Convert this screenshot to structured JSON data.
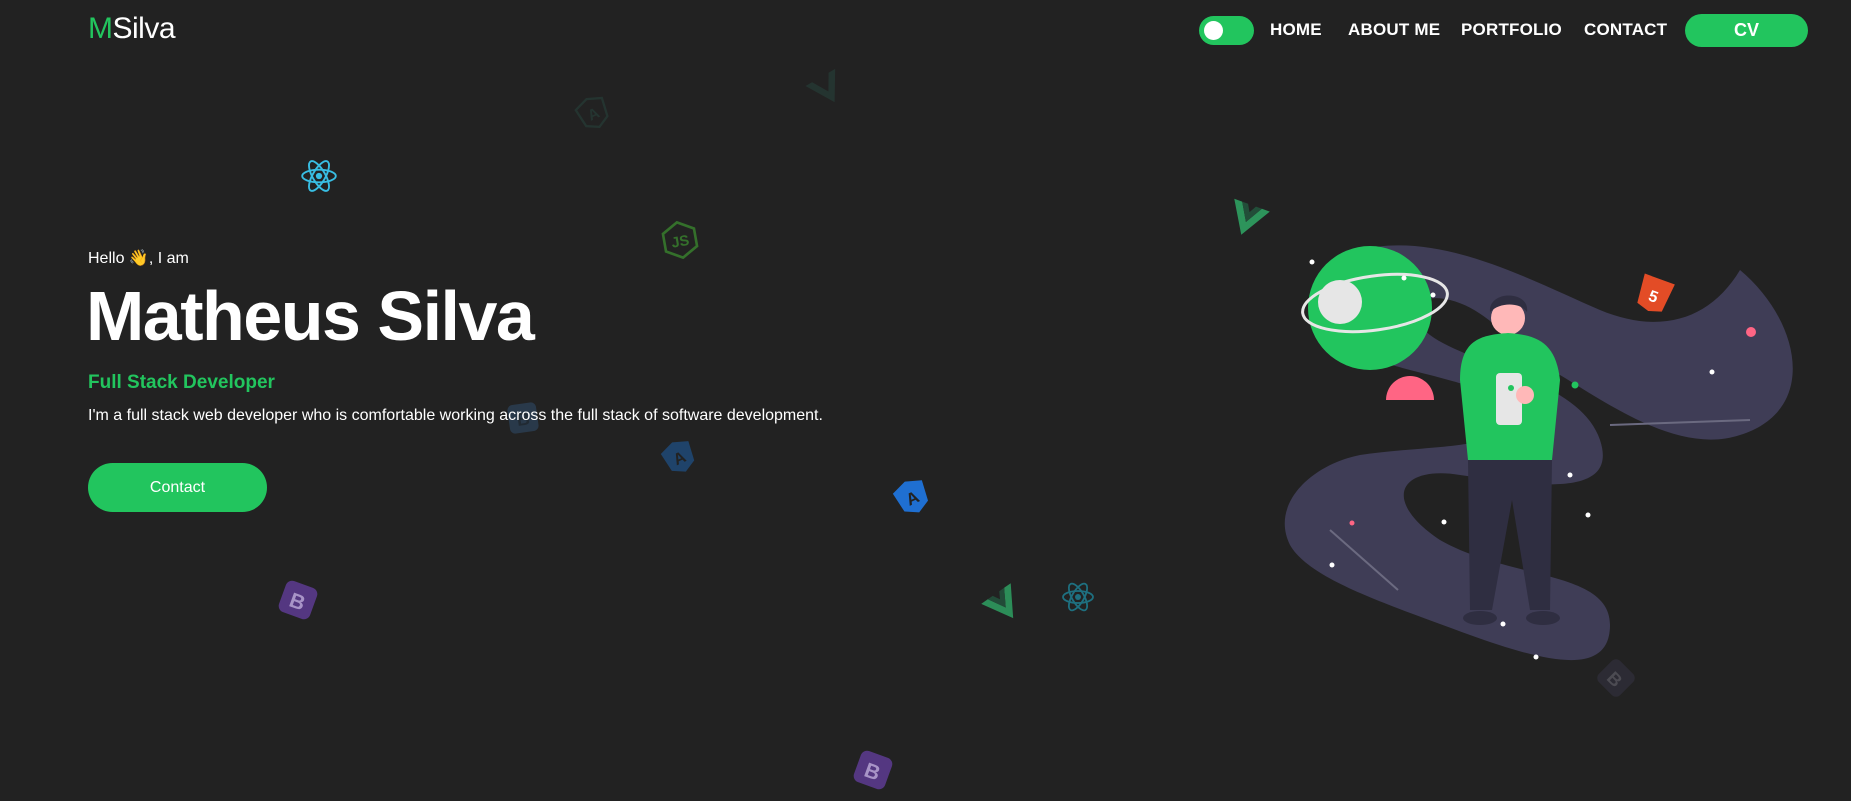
{
  "header": {
    "logo_first": "M",
    "logo_rest": "Silva",
    "theme_toggle_state": "on",
    "nav": [
      {
        "label": "HOME"
      },
      {
        "label": "ABOUT ME"
      },
      {
        "label": "PORTFOLIO"
      },
      {
        "label": "CONTACT"
      }
    ],
    "cv_label": "CV"
  },
  "hero": {
    "greeting": "Hello 👋, I am",
    "name": "Matheus Silva",
    "role": "Full Stack Developer",
    "description": "I'm a full stack web developer who is comfortable working across the full stack of software development.",
    "contact_label": "Contact"
  },
  "floating_icons": [
    "react-icon",
    "nodejs-icon",
    "angular-icon",
    "angular-icon",
    "vue-icon",
    "react-icon",
    "bootstrap-icon",
    "bootstrap-icon",
    "bootstrap-icon",
    "vue-icon",
    "html5-icon",
    "angular-icon",
    "vue-icon",
    "bootstrap-icon"
  ],
  "colors": {
    "background": "#222222",
    "accent": "#22c55e",
    "text": "#ffffff",
    "illustration_purple": "#3f3d56",
    "illustration_pink": "#ff6584"
  }
}
